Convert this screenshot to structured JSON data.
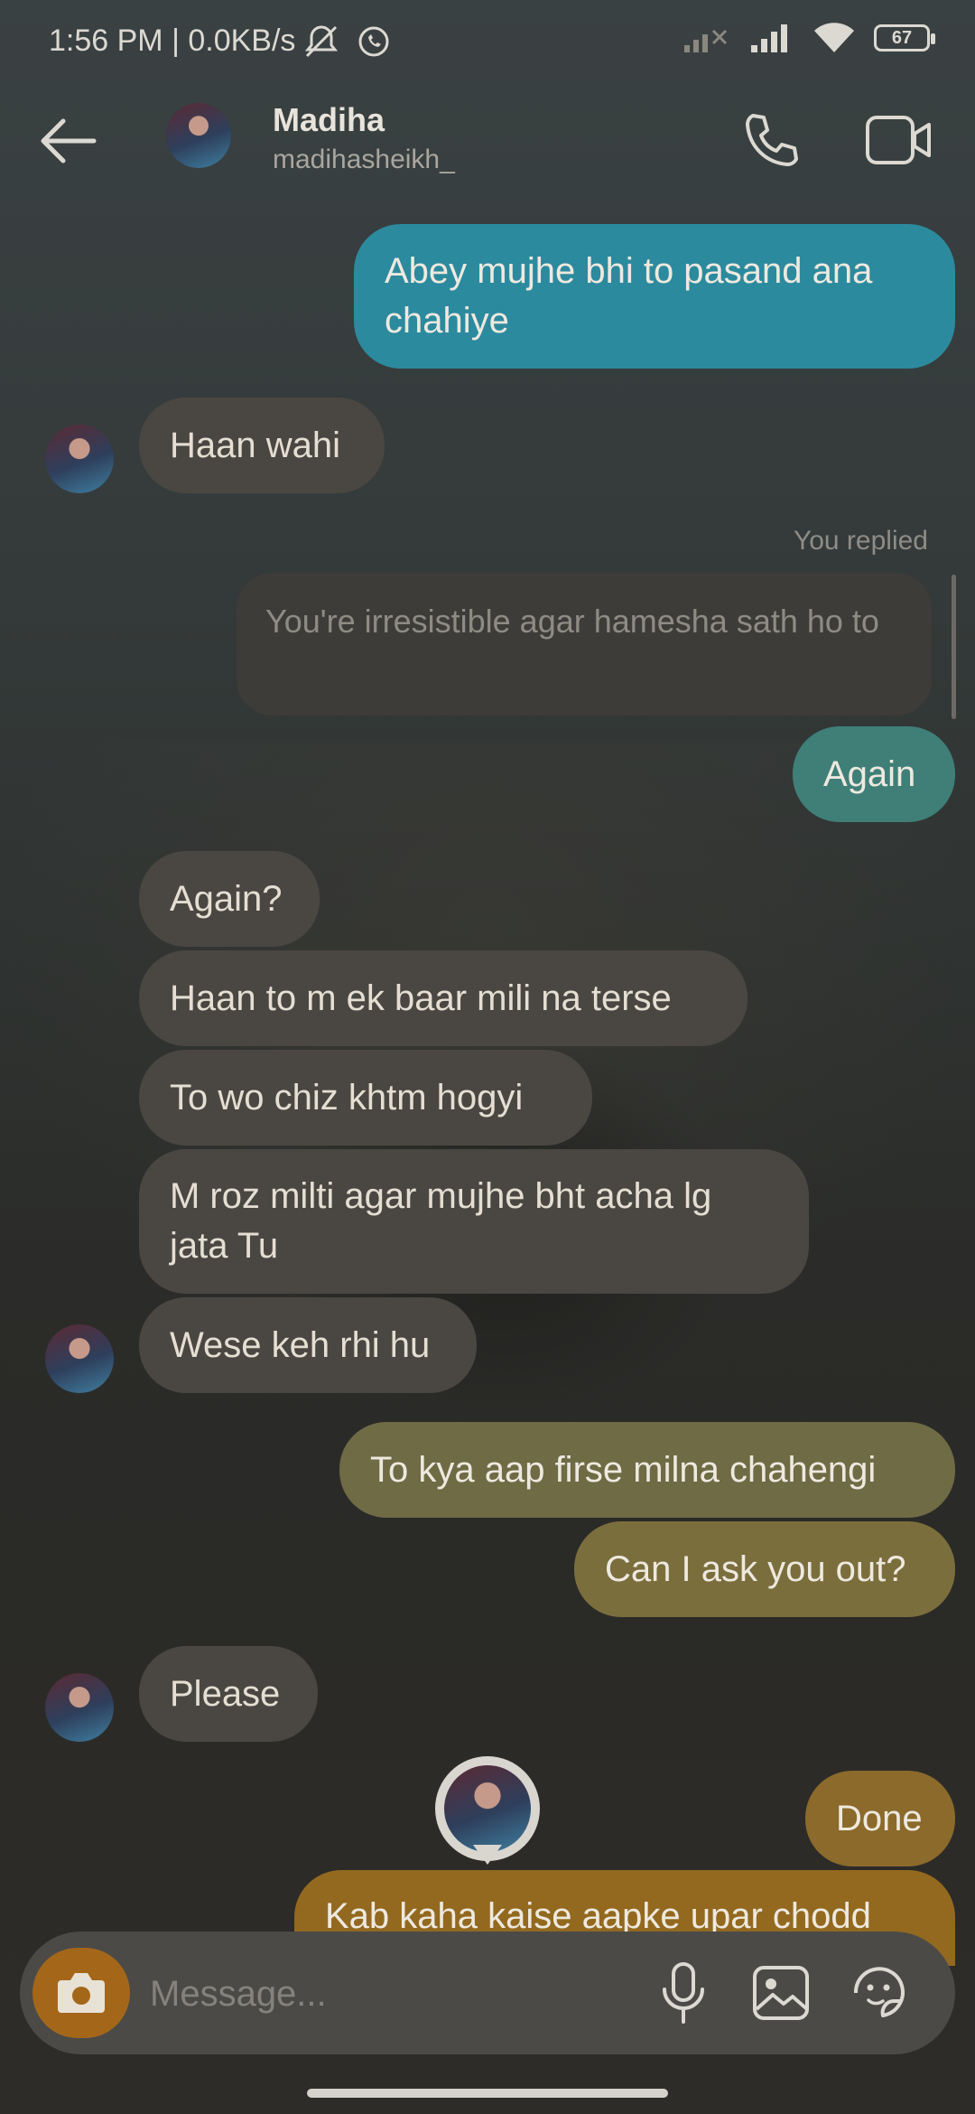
{
  "status_bar": {
    "time": "1:56 PM | 0.0KB/s",
    "battery": "67",
    "icons": [
      "mute-alarm-icon",
      "whatsapp-icon",
      "signal-x-icon",
      "signal-icon",
      "wifi-icon",
      "battery-icon"
    ]
  },
  "header": {
    "name": "Madiha",
    "username": "madihasheikh_"
  },
  "messages": {
    "m1": "Abey mujhe bhi to pasand ana chahiye",
    "m2": "Haan wahi",
    "replied_label": "You replied",
    "quoted": "You're irresistible agar hamesha sath ho to",
    "m3": "Again",
    "m4": "Again?",
    "m5": "Haan to m ek baar mili na terse",
    "m6": "To wo chiz khtm hogyi",
    "m7": "M roz milti agar mujhe bht acha lg jata Tu",
    "m8": "Wese keh rhi hu",
    "m9": "To kya aap firse milna chahengi",
    "m10": "Can I ask you out?",
    "m11": "Please",
    "m12": "Done",
    "m13": "Kab kaha kaise aapke upar chodd"
  },
  "composer": {
    "placeholder": "Message..."
  },
  "colors": {
    "sent_blue": "#2c8a9e",
    "sent_teal": "#3f7f78",
    "sent_olive": "#6e6b45",
    "sent_amber": "#8b6a2b",
    "received": "#4a4742",
    "camera_button": "#a4671a"
  }
}
